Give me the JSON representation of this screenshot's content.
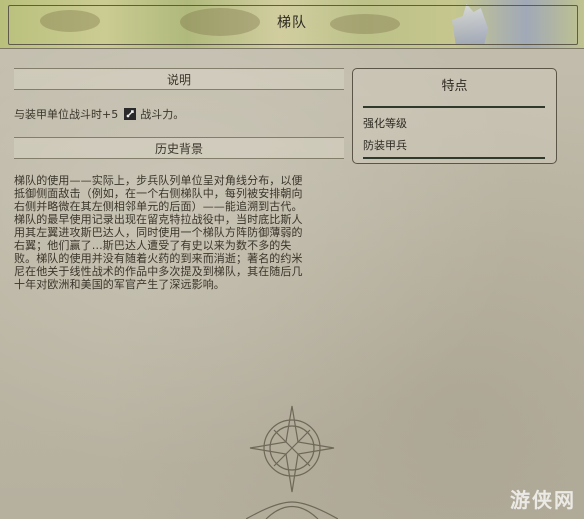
{
  "header": {
    "title": "梯队"
  },
  "description": {
    "heading": "说明",
    "ability_text": "与装甲单位战斗时+5",
    "ability_suffix": "战斗力。",
    "ability_icon": "combat-strength-icon"
  },
  "history": {
    "heading": "历史背景",
    "text": "梯队的使用——实际上，步兵队列单位呈对角线分布，以便\n抵御侧面敌击（例如，在一个右侧梯队中，每列被安排朝向\n右侧并略微在其左侧相邻单元的后面）——能追溯到古代。\n梯队的最早使用记录出现在留克特拉战役中，当时底比斯人\n用其左翼进攻斯巴达人，同时使用一个梯队方阵防御薄弱的\n右翼；他们赢了…斯巴达人遭受了有史以来为数不多的失\n败。梯队的使用并没有随着火药的到来而消逝；著名的约米\n尼在他关于线性战术的作品中多次提及到梯队，其在随后几\n十年对欧洲和美国的军官产生了深远影响。"
  },
  "features": {
    "title": "特点",
    "items": [
      "强化等级",
      "防装甲兵"
    ]
  },
  "watermark": "游侠网"
}
